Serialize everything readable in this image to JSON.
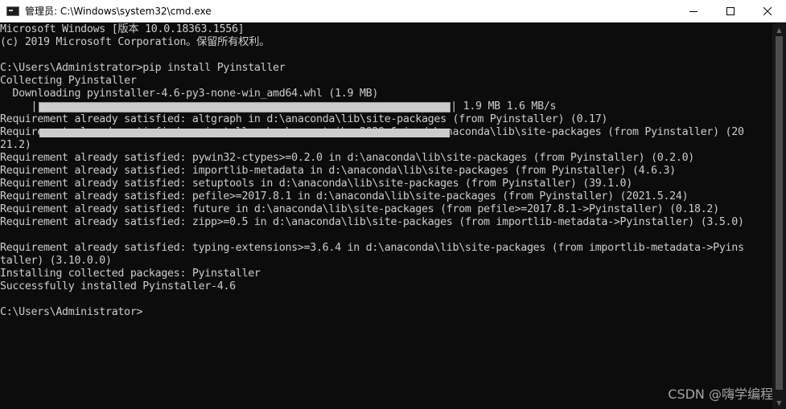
{
  "window": {
    "title": "管理员: C:\\Windows\\system32\\cmd.exe",
    "icon": "cmd-icon",
    "controls": [
      "minimize-icon",
      "maximize-icon",
      "close-icon"
    ]
  },
  "console": {
    "lines_before_progress": [
      "Microsoft Windows [版本 10.0.18363.1556]",
      "(c) 2019 Microsoft Corporation。保留所有权利。",
      "",
      "C:\\Users\\Administrator>pip install Pyinstaller",
      "Collecting Pyinstaller",
      "  Downloading pyinstaller-4.6-py3-none-win_amd64.whl (1.9 MB)"
    ],
    "progress": {
      "indent": "     |",
      "fraction": 1.0,
      "suffix": "| 1.9 MB 1.6 MB/s"
    },
    "lines_after_progress": [
      "Requirement already satisfied: altgraph in d:\\anaconda\\lib\\site-packages (from Pyinstaller) (0.17)",
      "Requirement already satisfied: pyinstaller-hooks-contrib>=2020.6 in d:\\anaconda\\lib\\site-packages (from Pyinstaller) (20",
      "21.2)",
      "Requirement already satisfied: pywin32-ctypes>=0.2.0 in d:\\anaconda\\lib\\site-packages (from Pyinstaller) (0.2.0)",
      "Requirement already satisfied: importlib-metadata in d:\\anaconda\\lib\\site-packages (from Pyinstaller) (4.6.3)",
      "Requirement already satisfied: setuptools in d:\\anaconda\\lib\\site-packages (from Pyinstaller) (39.1.0)",
      "Requirement already satisfied: pefile>=2017.8.1 in d:\\anaconda\\lib\\site-packages (from Pyinstaller) (2021.5.24)",
      "Requirement already satisfied: future in d:\\anaconda\\lib\\site-packages (from pefile>=2017.8.1->Pyinstaller) (0.18.2)",
      "Requirement already satisfied: zipp>=0.5 in d:\\anaconda\\lib\\site-packages (from importlib-metadata->Pyinstaller) (3.5.0)",
      "",
      "Requirement already satisfied: typing-extensions>=3.6.4 in d:\\anaconda\\lib\\site-packages (from importlib-metadata->Pyins",
      "taller) (3.10.0.0)",
      "Installing collected packages: Pyinstaller",
      "Successfully installed Pyinstaller-4.6",
      "",
      "C:\\Users\\Administrator>"
    ]
  },
  "watermark": "CSDN @嗨学编程",
  "colors": {
    "console_bg": "#0c0c0c",
    "console_text": "#cccccc",
    "titlebar_bg": "#ffffff"
  }
}
